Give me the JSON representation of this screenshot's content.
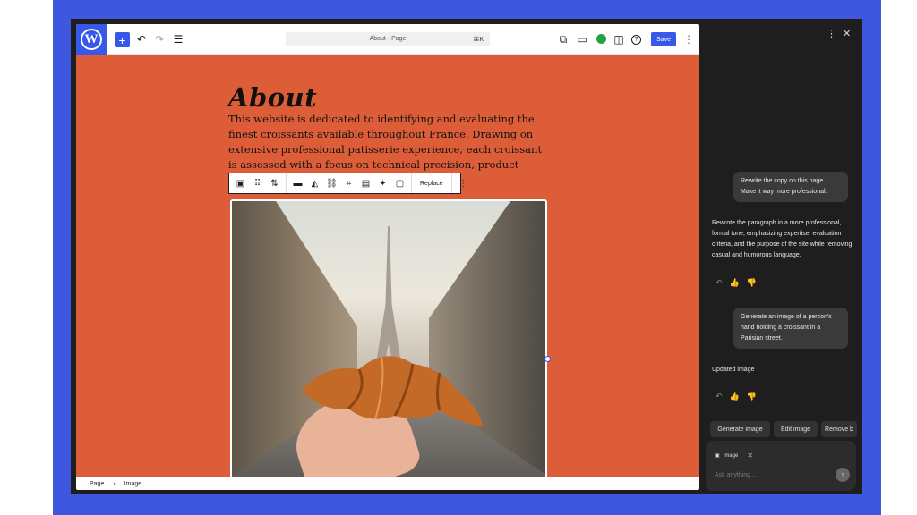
{
  "colors": {
    "frame": "#3f57de",
    "canvas": "#dd5d39",
    "accent": "#3858e9",
    "sidebar": "#1e1e1e"
  },
  "topbar": {
    "logo_icon": "wordpress-logo",
    "logo_glyph": "W",
    "add_glyph": "+",
    "undo_glyph": "↶",
    "redo_glyph": "↷",
    "list_glyph": "☰",
    "command_title": "About · Page",
    "command_shortcut": "⌘K",
    "view_glyph": "⧉",
    "device_glyph": "▭",
    "sidebar_glyph": "◫",
    "help_glyph": "?",
    "save_label": "Save",
    "options_glyph": "⋮"
  },
  "content": {
    "heading": "About",
    "paragraph": "This website is dedicated to identifying and evaluating the finest croissants available throughout France. Drawing on extensive professional patisserie experience, each croissant is assessed with a focus on technical precision, product"
  },
  "block_toolbar": {
    "replace_label": "Replace",
    "icons": [
      "image-icon",
      "drag-icon",
      "move-icon",
      "align-icon",
      "duotone-icon",
      "link-icon",
      "crop-icon",
      "text-overlay-icon",
      "ai-icon",
      "caption-icon"
    ],
    "glyphs": {
      "image": "▣",
      "drag": "⠿",
      "move": "⇅",
      "align": "▬",
      "duotone": "◭",
      "link": "⛓",
      "crop": "⌗",
      "overlay": "▤",
      "ai": "✦",
      "caption": "▢",
      "more": "⋮"
    }
  },
  "breadcrumb": {
    "page": "Page",
    "separator": "›",
    "block": "Image"
  },
  "sidebar": {
    "more_glyph": "⋮",
    "close_glyph": "✕",
    "messages": [
      {
        "role": "user",
        "text": "Rewrite the copy on this page. Make it way more professional."
      },
      {
        "role": "assistant",
        "text": "Rewrote the paragraph in a more professional, formal tone, emphasizing expertise, evaluation criteria, and the purpose of the site while removing casual and humorous language."
      },
      {
        "role": "user",
        "text": "Generate an image of a person's hand holding a croissant in a Parisian street."
      },
      {
        "role": "assistant",
        "text": "Updated image"
      }
    ],
    "feedback": {
      "undo": "↶",
      "up": "👍",
      "down": "👎"
    },
    "chips": [
      "Generate image",
      "Edit image",
      "Remove b"
    ],
    "composer": {
      "tag_icon": "▣",
      "tag_label": "Image",
      "tag_close": "✕",
      "placeholder": "Ask anything...",
      "send_glyph": "↑"
    }
  }
}
